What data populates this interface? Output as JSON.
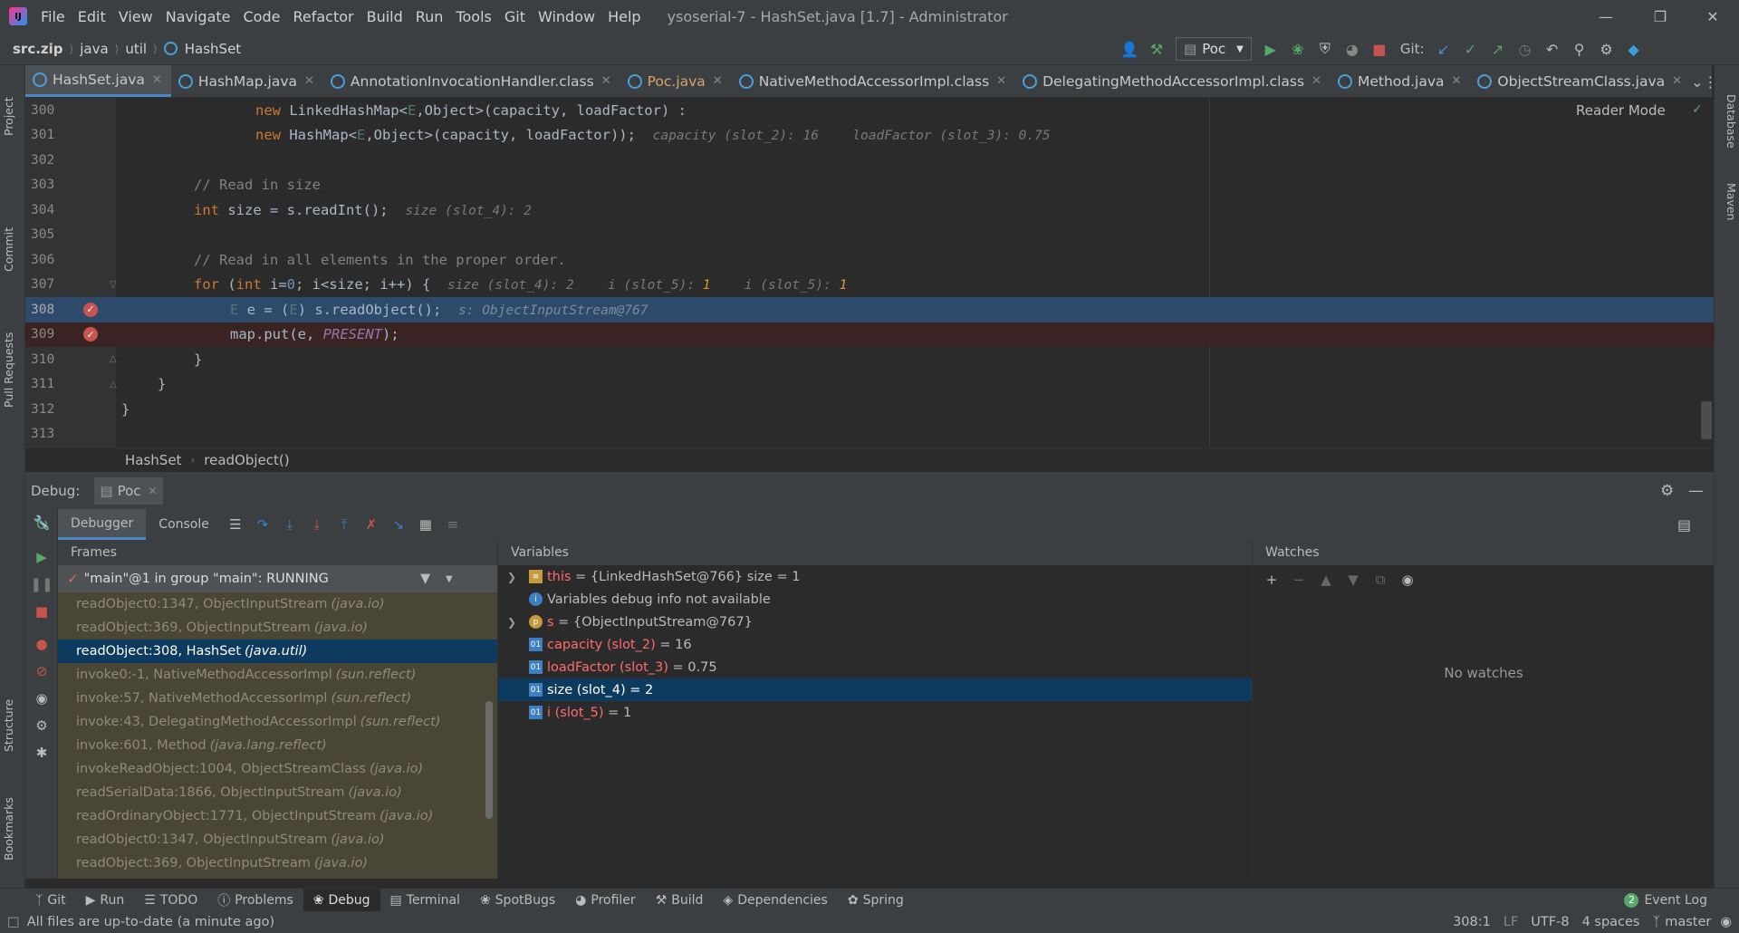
{
  "menubar": {
    "items": [
      "File",
      "Edit",
      "View",
      "Navigate",
      "Code",
      "Refactor",
      "Build",
      "Run",
      "Tools",
      "Git",
      "Window",
      "Help"
    ],
    "title": "ysoserial-7 - HashSet.java [1.7] - Administrator"
  },
  "navbar": {
    "crumbs": [
      "src.zip",
      "java",
      "util",
      "HashSet"
    ],
    "run_config": "Poc",
    "git_label": "Git:"
  },
  "tabs": [
    {
      "label": "HashSet.java",
      "active": true
    },
    {
      "label": "HashMap.java",
      "active": false
    },
    {
      "label": "AnnotationInvocationHandler.class",
      "active": false
    },
    {
      "label": "Poc.java",
      "active": false,
      "color": "#d6a36b"
    },
    {
      "label": "NativeMethodAccessorImpl.class",
      "active": false
    },
    {
      "label": "DelegatingMethodAccessorImpl.class",
      "active": false
    },
    {
      "label": "Method.java",
      "active": false
    },
    {
      "label": "ObjectStreamClass.java",
      "active": false
    }
  ],
  "left_strip": [
    "Project",
    "Commit",
    "Pull Requests",
    "Structure",
    "Bookmarks"
  ],
  "right_strip": [
    "Database",
    "Maven"
  ],
  "editor": {
    "reader_mode": "Reader Mode",
    "lines": [
      {
        "num": "300"
      },
      {
        "num": "301"
      },
      {
        "num": "302"
      },
      {
        "num": "303"
      },
      {
        "num": "304"
      },
      {
        "num": "305"
      },
      {
        "num": "306"
      },
      {
        "num": "307"
      },
      {
        "num": "308"
      },
      {
        "num": "309"
      },
      {
        "num": "310"
      },
      {
        "num": "311"
      },
      {
        "num": "312"
      },
      {
        "num": "313"
      }
    ],
    "code": {
      "l300_new": "new ",
      "l300_type": "LinkedHashMap",
      "l300_gen": "<",
      "l300_e": "E",
      "l300_rest": ",Object>(capacity, loadFactor) :",
      "l301_new": "new ",
      "l301_type": "HashMap",
      "l301_gen": "<",
      "l301_e": "E",
      "l301_rest": ",Object>(capacity, loadFactor));",
      "l301_hint1": "capacity (slot_2): 16",
      "l301_hint2": "loadFactor (slot_3): 0.75",
      "l303_comment": "// Read in size",
      "l304_int": "int ",
      "l304_rest": "size = s.readInt();",
      "l304_hint": "size (slot_4): 2",
      "l306_comment": "// Read in all elements in the proper order.",
      "l307_for": "for ",
      "l307_a": "(",
      "l307_int": "int ",
      "l307_rest": "i=",
      "l307_zero": "0",
      "l307_rest2": "; i<size; i++) {",
      "l307_hint1": "size (slot_4): 2",
      "l307_hint2": "i (slot_5): ",
      "l307_hint2v": "1",
      "l307_hint3": "i (slot_5): ",
      "l307_hint3v": "1",
      "l308_e": "E",
      "l308_rest": " e = (",
      "l308_e2": "E",
      "l308_rest2": ") s.readObject();",
      "l308_hint": "s: ObjectInputStream@767",
      "l309_rest": "map.put(e, ",
      "l309_const": "PRESENT",
      "l309_end": ");",
      "l310": "}",
      "l311": "}",
      "l312": "}"
    }
  },
  "breadcrumbs": [
    "HashSet",
    "readObject()"
  ],
  "debug": {
    "label": "Debug:",
    "session": "Poc",
    "tabs": [
      "Debugger",
      "Console"
    ],
    "frames_header": "Frames",
    "thread": "\"main\"@1 in group \"main\": RUNNING",
    "frames": [
      {
        "name": "readObject0:1347, ObjectInputStream",
        "pkg": "(java.io)",
        "selected": false
      },
      {
        "name": "readObject:369, ObjectInputStream",
        "pkg": "(java.io)",
        "selected": false
      },
      {
        "name": "readObject:308, HashSet",
        "pkg": "(java.util)",
        "selected": true
      },
      {
        "name": "invoke0:-1, NativeMethodAccessorImpl",
        "pkg": "(sun.reflect)",
        "selected": false
      },
      {
        "name": "invoke:57, NativeMethodAccessorImpl",
        "pkg": "(sun.reflect)",
        "selected": false
      },
      {
        "name": "invoke:43, DelegatingMethodAccessorImpl",
        "pkg": "(sun.reflect)",
        "selected": false
      },
      {
        "name": "invoke:601, Method",
        "pkg": "(java.lang.reflect)",
        "selected": false
      },
      {
        "name": "invokeReadObject:1004, ObjectStreamClass",
        "pkg": "(java.io)",
        "selected": false
      },
      {
        "name": "readSerialData:1866, ObjectInputStream",
        "pkg": "(java.io)",
        "selected": false
      },
      {
        "name": "readOrdinaryObject:1771, ObjectInputStream",
        "pkg": "(java.io)",
        "selected": false
      },
      {
        "name": "readObject0:1347, ObjectInputStream",
        "pkg": "(java.io)",
        "selected": false
      },
      {
        "name": "readObject:369, ObjectInputStream",
        "pkg": "(java.io)",
        "selected": false
      }
    ],
    "variables_header": "Variables",
    "variables": [
      {
        "name": "this",
        "value": " = {LinkedHashSet@766}  size = 1",
        "expandable": true,
        "icon": "field-icon",
        "icolor": "#c59a3c",
        "selected": false
      },
      {
        "name": "",
        "value": "Variables debug info not available",
        "expandable": false,
        "icon": "info-icon",
        "icolor": "#3d7fc4",
        "selected": false
      },
      {
        "name": "s",
        "value": " = {ObjectInputStream@767}",
        "expandable": true,
        "icon": "param-icon",
        "icolor": "#c59a3c",
        "selected": false
      },
      {
        "name": "capacity (slot_2)",
        "value": " = 16",
        "expandable": false,
        "icon": "primitive-icon",
        "icolor": "#3d7fc4",
        "selected": false
      },
      {
        "name": "loadFactor (slot_3)",
        "value": " = 0.75",
        "expandable": false,
        "icon": "primitive-icon",
        "icolor": "#3d7fc4",
        "selected": false
      },
      {
        "name": "size (slot_4)",
        "value": " = 2",
        "expandable": false,
        "icon": "primitive-icon",
        "icolor": "#3d7fc4",
        "selected": true
      },
      {
        "name": "i (slot_5)",
        "value": " = 1",
        "expandable": false,
        "icon": "primitive-icon",
        "icolor": "#3d7fc4",
        "selected": false
      }
    ],
    "watches_header": "Watches",
    "no_watches": "No watches"
  },
  "bottom_tools": [
    "Git",
    "Run",
    "TODO",
    "Problems",
    "Debug",
    "Terminal",
    "SpotBugs",
    "Profiler",
    "Build",
    "Dependencies",
    "Spring"
  ],
  "event_log": {
    "count": "2",
    "label": "Event Log"
  },
  "status": {
    "message": "All files are up-to-date (a minute ago)",
    "position": "308:1",
    "line_sep": "LF",
    "encoding": "UTF-8",
    "indent": "4 spaces",
    "branch": "master"
  },
  "colors": {
    "accent": "#4a88c7",
    "breakpoint": "#c75450",
    "selection": "#0d3a5f",
    "current_line": "#2e4a6b",
    "bp_line": "#3a2323"
  }
}
